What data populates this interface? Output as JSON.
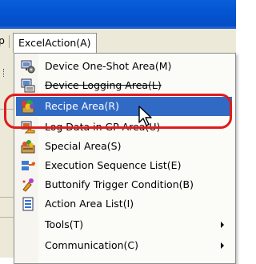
{
  "menubar": {
    "prev_menu_label": "p",
    "active_menu_label": "ExcelAction(A)"
  },
  "dropdown": {
    "items": [
      {
        "label": "Device One-Shot Area(M)",
        "icon": "device-oneshot-icon"
      },
      {
        "label": "Device Logging Area(L)",
        "icon": "device-logging-icon"
      },
      {
        "label": "Recipe Area(R)",
        "icon": "recipe-icon",
        "selected": true
      },
      {
        "label": "Log Data in GP Area(U)",
        "icon": "log-data-icon"
      },
      {
        "label": "Special Area(S)",
        "icon": "special-area-icon"
      },
      {
        "label": "Execution Sequence List(E)",
        "icon": "execution-sequence-icon"
      },
      {
        "label": "Buttonify Trigger Condition(B)",
        "icon": "buttonify-trigger-icon"
      },
      {
        "label": "Action Area List(I)",
        "icon": "action-area-list-icon"
      },
      {
        "label": "Tools(T)",
        "submenu": true
      },
      {
        "label": "Communication(C)",
        "submenu": true
      }
    ]
  },
  "colors": {
    "selection": "#316ac5",
    "highlight_ring": "#e01b1b",
    "titlebar": "#0554d1"
  }
}
